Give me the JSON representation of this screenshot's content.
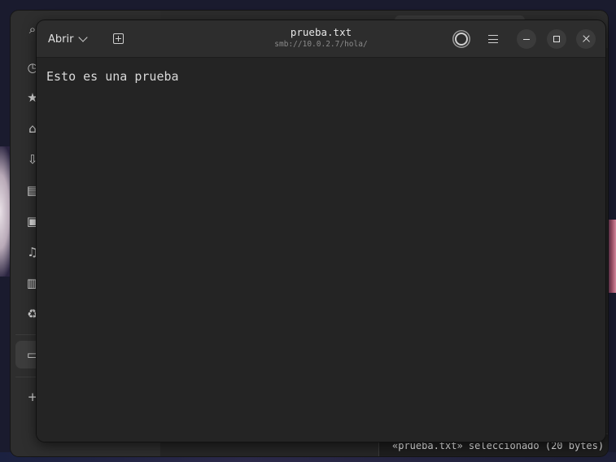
{
  "file_manager": {
    "sidebar_icons": [
      "search-icon",
      "recent-icon",
      "starred-icon",
      "home-icon",
      "downloads-icon",
      "documents-icon",
      "pictures-icon",
      "music-icon",
      "videos-icon",
      "trash-icon",
      "network-icon",
      "add-location-icon"
    ],
    "status_text": "«prueba.txt» seleccionado (20 bytes)"
  },
  "editor": {
    "open_label": "Abrir",
    "title": "prueba.txt",
    "subtitle": "smb://10.0.2.7/hola/",
    "text": "Esto es una prueba"
  },
  "colors": {
    "window_bg": "#242424",
    "headerbar_bg": "#2d2d2d",
    "text": "#d9d9d9"
  }
}
